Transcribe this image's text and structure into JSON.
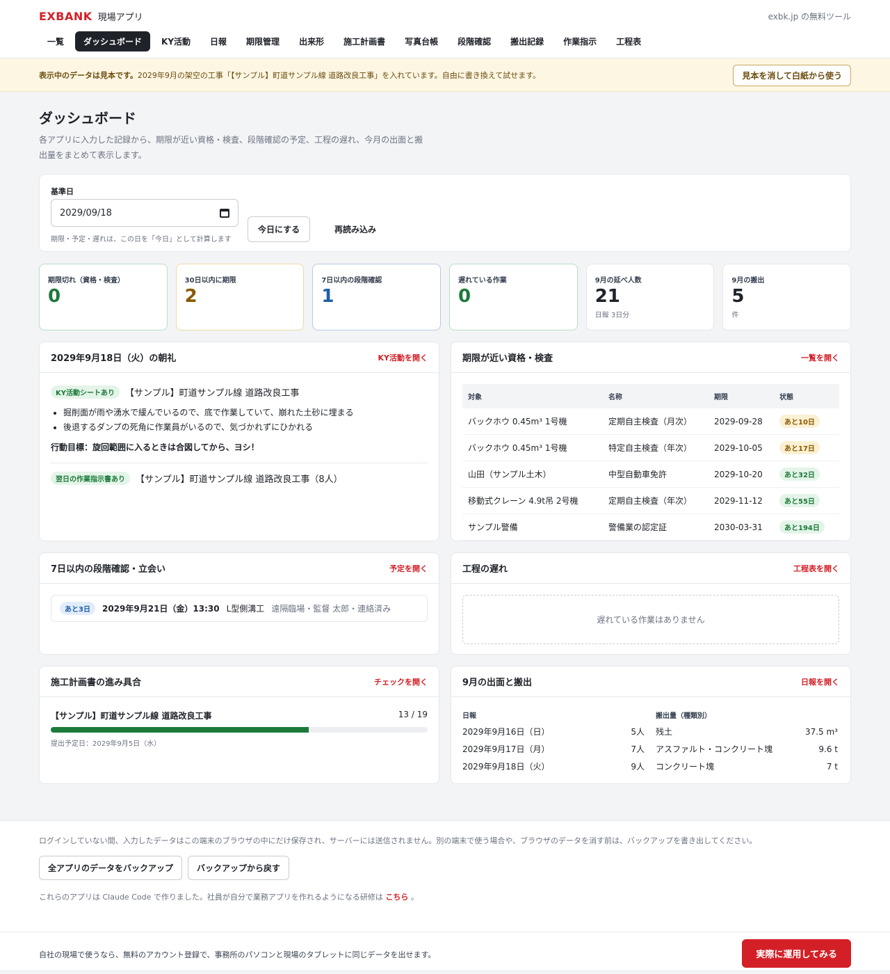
{
  "header": {
    "logo": "EXBANK",
    "app_name": "現場アプリ",
    "right_text": "exbk.jp の無料ツール",
    "nav": [
      {
        "label": "一覧"
      },
      {
        "label": "ダッシュボード"
      },
      {
        "label": "KY活動"
      },
      {
        "label": "日報"
      },
      {
        "label": "期限管理"
      },
      {
        "label": "出来形"
      },
      {
        "label": "施工計画書"
      },
      {
        "label": "写真台帳"
      },
      {
        "label": "段階確認"
      },
      {
        "label": "搬出記録"
      },
      {
        "label": "作業指示"
      },
      {
        "label": "工程表"
      }
    ]
  },
  "banner": {
    "bold": "表示中のデータは見本です。",
    "text": "2029年9月の架空の工事「【サンプル】町道サンプル線 道路改良工事」を入れています。自由に書き換えて試せます。",
    "button": "見本を消して白紙から使う"
  },
  "page": {
    "title": "ダッシュボード",
    "desc": "各アプリに入力した記録から、期限が近い資格・検査、段階確認の予定、工程の遅れ、今月の出面と搬出量をまとめて表示します。"
  },
  "date_card": {
    "label": "基準日",
    "value": "2029/09/18",
    "hint": "期限・予定・遅れは、この日を「今日」として計算します",
    "today_button": "今日にする",
    "reload_button": "再読み込み"
  },
  "stats": [
    {
      "label": "期限切れ（資格・検査）",
      "value": "0",
      "sub": "",
      "color": "#1c7a3a"
    },
    {
      "label": "30日以内に期限",
      "value": "2",
      "sub": "",
      "color": "#8a5a00"
    },
    {
      "label": "7日以内の段階確認",
      "value": "1",
      "sub": "",
      "color": "#1d5fa8"
    },
    {
      "label": "遅れている作業",
      "value": "0",
      "sub": "",
      "color": "#1c7a3a"
    },
    {
      "label": "9月の延べ人数",
      "value": "21",
      "sub": "日報 3日分",
      "color": "#1f2329"
    },
    {
      "label": "9月の搬出",
      "value": "5",
      "sub": "件",
      "color": "#1f2329"
    }
  ],
  "morning": {
    "title": "2029年9月18日（火）の朝礼",
    "link": "KY活動を開く",
    "tag": "KY活動シートあり",
    "project": "【サンプル】町道サンプル線 道路改良工事",
    "items": [
      "掘削面が雨や湧水で緩んでいるので、底で作業していて、崩れた土砂に埋まる",
      "後退するダンプの死角に作業員がいるので、気づかれずにひかれる"
    ],
    "goal": "行動目標：旋回範囲に入るときは合図してから、ヨシ！",
    "next_tag": "翌日の作業指示書あり",
    "next_text": "【サンプル】町道サンプル線 道路改良工事（8人）"
  },
  "deadlines": {
    "title": "期限が近い資格・検査",
    "link": "一覧を開く",
    "headers": [
      "対象",
      "名称",
      "期限",
      "状態"
    ],
    "rows": [
      {
        "target": "バックホウ 0.45m³ 1号機",
        "name": "定期自主検査（月次）",
        "date": "2029-09-28",
        "status": "あと10日",
        "tone": "yellow"
      },
      {
        "target": "バックホウ 0.45m³ 1号機",
        "name": "特定自主検査（年次）",
        "date": "2029-10-05",
        "status": "あと17日",
        "tone": "yellow"
      },
      {
        "target": "山田（サンプル土木）",
        "name": "中型自動車免許",
        "date": "2029-10-20",
        "status": "あと32日",
        "tone": "green"
      },
      {
        "target": "移動式クレーン 4.9t吊 2号機",
        "name": "定期自主検査（年次）",
        "date": "2029-11-12",
        "status": "あと55日",
        "tone": "green"
      },
      {
        "target": "サンプル警備",
        "name": "警備業の認定証",
        "date": "2030-03-31",
        "status": "あと194日",
        "tone": "green"
      }
    ]
  },
  "steps": {
    "title": "7日以内の段階確認・立会い",
    "link": "予定を開く",
    "tag": "あと3日",
    "date": "2029年9月21日（金）13:30",
    "item": "L型側溝工",
    "info": "遠隔臨場・監督 太郎・連絡済み"
  },
  "delays": {
    "title": "工程の遅れ",
    "link": "工程表を開く",
    "empty": "遅れている作業はありません"
  },
  "plan": {
    "title": "施工計画書の進み具合",
    "link": "チェックを開く",
    "project": "【サンプル】町道サンプル線 道路改良工事",
    "count": "13 / 19",
    "progress": 0.684,
    "sub": "提出予定日：2029年9月5日（水）"
  },
  "monthly": {
    "title": "9月の出面と搬出",
    "link": "日報を開く",
    "left_label": "日報",
    "right_label": "搬出量（種類別）",
    "days": [
      {
        "date": "2029年9月16日（日）",
        "count": "5人"
      },
      {
        "date": "2029年9月17日（月）",
        "count": "7人"
      },
      {
        "date": "2029年9月18日（火）",
        "count": "9人"
      }
    ],
    "hauls": [
      {
        "type": "残土",
        "amount": "37.5 m³"
      },
      {
        "type": "アスファルト・コンクリート塊",
        "amount": "9.6 t"
      },
      {
        "type": "コンクリート塊",
        "amount": "7 t"
      }
    ]
  },
  "footer": {
    "note": "ログインしていない間、入力したデータはこの端末のブラウザの中にだけ保存され、サーバーには送信されません。別の端末で使う場合や、ブラウザのデータを消す前は、バックアップを書き出してください。",
    "backup_button": "全アプリのデータをバックアップ",
    "restore_button": "バックアップから戻す",
    "credit_prefix": "これらのアプリは Claude Code で作りました。社員が自分で業務アプリを作れるようになる研修は",
    "credit_link": "こちら",
    "credit_suffix": "。",
    "bottom_text": "自社の現場で使うなら、無料のアカウント登録で、事務所のパソコンと現場のタブレットに同じデータを出せます。",
    "cta": "実際に運用してみる"
  }
}
